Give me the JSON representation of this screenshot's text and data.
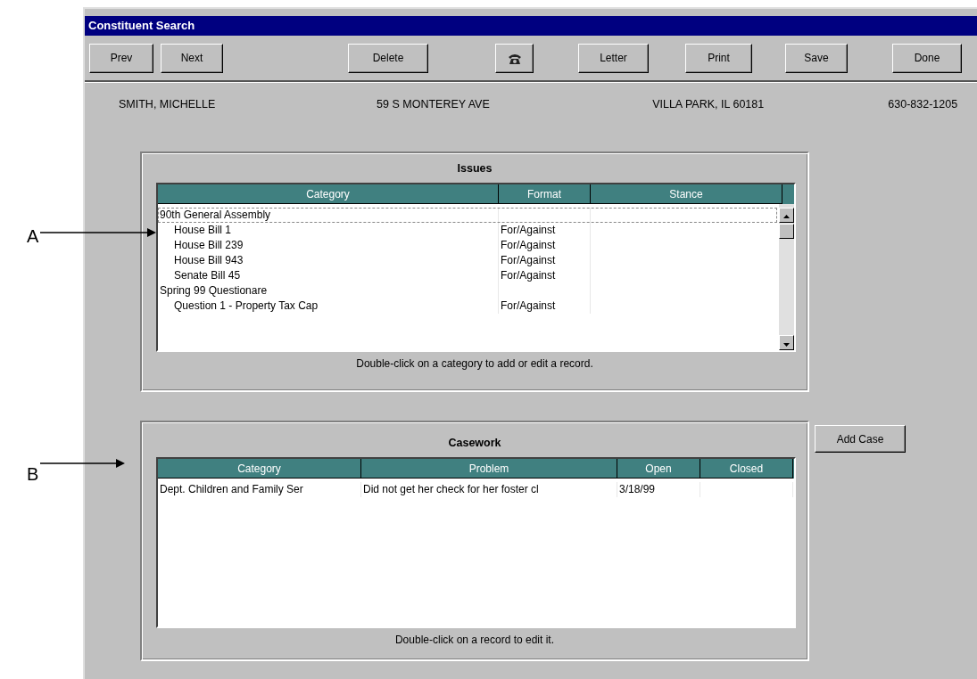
{
  "window": {
    "title": "Constituent Search"
  },
  "toolbar": [
    {
      "kind": "text",
      "label": "Prev"
    },
    {
      "kind": "text",
      "label": "Next"
    },
    {
      "kind": "text",
      "label": "Delete"
    },
    {
      "kind": "phone"
    },
    {
      "kind": "text",
      "label": "Letter"
    },
    {
      "kind": "text",
      "label": "Print"
    },
    {
      "kind": "text",
      "label": "Save"
    },
    {
      "kind": "text",
      "label": "Done"
    }
  ],
  "constituent": {
    "name": "SMITH, MICHELLE",
    "address": "59 S MONTEREY AVE",
    "city": "VILLA PARK, IL  60181",
    "phone": "630-832-1205"
  },
  "issues": {
    "title": "Issues",
    "columns": [
      "Category",
      "Format",
      "Stance"
    ],
    "rows": [
      {
        "category": "90th General Assembly",
        "selected": true,
        "children": [
          {
            "category": "House Bill 1",
            "format": "For/Against",
            "selected": false
          },
          {
            "category": "House Bill 239",
            "format": "For/Against",
            "selected": false
          },
          {
            "category": "House Bill 943",
            "format": "For/Against",
            "selected": false
          },
          {
            "category": "Senate Bill 45",
            "format": "For/Against",
            "selected": false
          }
        ]
      },
      {
        "category": "Spring 99 Questionare",
        "selected": false,
        "children": [
          {
            "category": "Question 1 - Property Tax Cap",
            "format": "For/Against",
            "selected": false
          }
        ]
      }
    ],
    "hint": "Double-click on a category to add or edit a record."
  },
  "casework": {
    "title": "Casework",
    "columns": [
      "Category",
      "Problem",
      "Open",
      "Closed"
    ],
    "rows": [
      {
        "category": "Dept. Children and Family Ser",
        "problem": "Did not get her check for her foster cl",
        "open": "3/18/99"
      }
    ],
    "hint": "Double-click on a record to edit it."
  },
  "add_case_button": "Add Case",
  "annotations": [
    {
      "label": "A"
    },
    {
      "label": "B"
    }
  ]
}
